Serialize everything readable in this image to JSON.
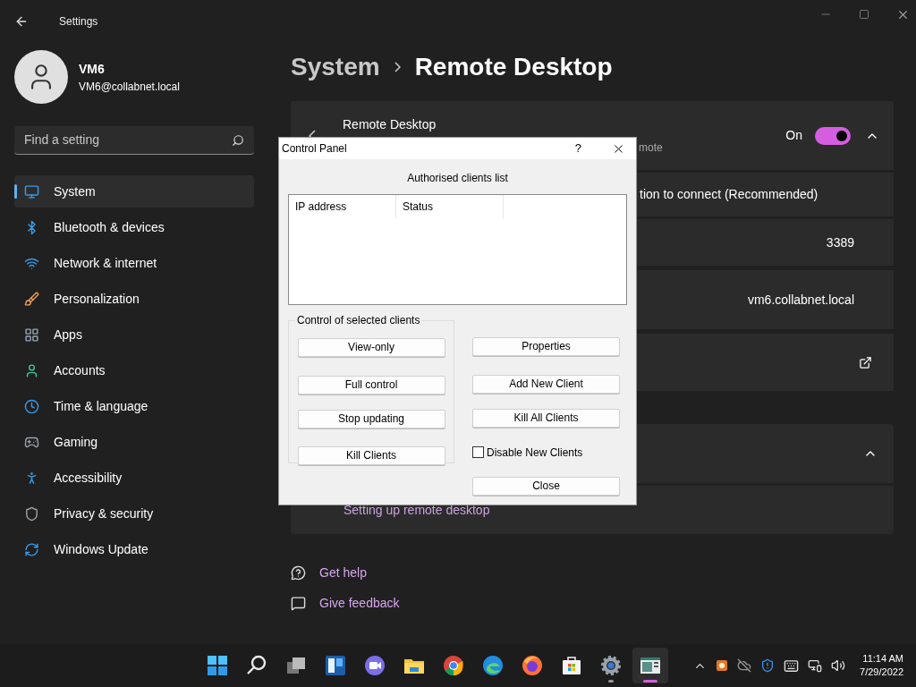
{
  "window": {
    "title": "Settings"
  },
  "user": {
    "name": "VM6",
    "email": "VM6@collabnet.local"
  },
  "search": {
    "placeholder": "Find a setting"
  },
  "sidebar": {
    "items": [
      {
        "label": "System",
        "selected": true
      },
      {
        "label": "Bluetooth & devices",
        "selected": false
      },
      {
        "label": "Network & internet",
        "selected": false
      },
      {
        "label": "Personalization",
        "selected": false
      },
      {
        "label": "Apps",
        "selected": false
      },
      {
        "label": "Accounts",
        "selected": false
      },
      {
        "label": "Time & language",
        "selected": false
      },
      {
        "label": "Gaming",
        "selected": false
      },
      {
        "label": "Accessibility",
        "selected": false
      },
      {
        "label": "Privacy & security",
        "selected": false
      },
      {
        "label": "Windows Update",
        "selected": false
      }
    ]
  },
  "breadcrumb": {
    "parent": "System",
    "current": "Remote Desktop"
  },
  "remote_desktop": {
    "title": "Remote Desktop",
    "description": "mote",
    "toggle_label": "On",
    "on": true,
    "expanded": true
  },
  "settings_rows": [
    {
      "kind": "text",
      "text": "tion to connect (Recommended)"
    },
    {
      "kind": "value",
      "value": "3389"
    },
    {
      "kind": "value",
      "value": "vm6.collabnet.local"
    },
    {
      "kind": "link"
    }
  ],
  "second_card": {
    "expanded": true,
    "link": "Setting up remote desktop"
  },
  "help_links": [
    "Get help",
    "Give feedback"
  ],
  "dialog": {
    "title": "Control Panel",
    "help": "?",
    "list_label": "Authorised clients list",
    "columns": [
      "IP address",
      "Status"
    ],
    "group_label": "Control of selected clients",
    "group_buttons": [
      "View-only",
      "Full control",
      "Stop updating",
      "Kill Clients"
    ],
    "side_buttons": [
      "Properties",
      "Add New Client",
      "Kill All Clients"
    ],
    "checkbox": {
      "label": "Disable New Clients",
      "checked": false
    },
    "close_button": "Close"
  },
  "taskbar": {
    "apps": [
      {
        "running": false,
        "active": false
      },
      {
        "running": false,
        "active": false
      },
      {
        "running": false,
        "active": false
      },
      {
        "running": false,
        "active": false
      },
      {
        "running": false,
        "active": false
      },
      {
        "running": false,
        "active": false
      },
      {
        "running": false,
        "active": false
      },
      {
        "running": false,
        "active": false
      },
      {
        "running": false,
        "active": false
      },
      {
        "running": false,
        "active": false
      },
      {
        "running": true,
        "active": false
      },
      {
        "running": true,
        "active": true
      }
    ],
    "time": "11:14 AM",
    "date": "7/29/2022"
  }
}
